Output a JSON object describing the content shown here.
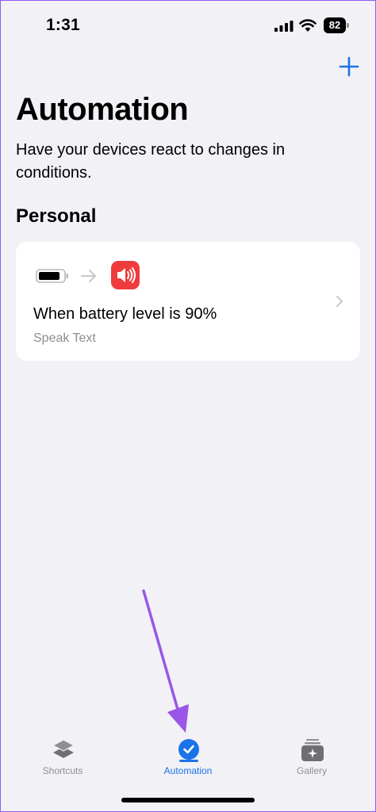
{
  "status_bar": {
    "time": "1:31",
    "battery_level": "82"
  },
  "header": {
    "title": "Automation",
    "subtitle": "Have your devices react to changes in conditions."
  },
  "section": {
    "title": "Personal"
  },
  "automation": {
    "title": "When battery level is 90%",
    "action": "Speak Text",
    "trigger_icon": "battery-icon",
    "action_icon": "speaker-icon"
  },
  "tabs": [
    {
      "label": "Shortcuts",
      "icon": "layers-icon",
      "active": false
    },
    {
      "label": "Automation",
      "icon": "checkmark-circle-icon",
      "active": true
    },
    {
      "label": "Gallery",
      "icon": "gallery-stack-icon",
      "active": false
    }
  ],
  "colors": {
    "accent": "#1a73e8",
    "action_red": "#ef3b3b",
    "annotation_arrow": "#9b55e8",
    "background": "#f2f1f6"
  }
}
